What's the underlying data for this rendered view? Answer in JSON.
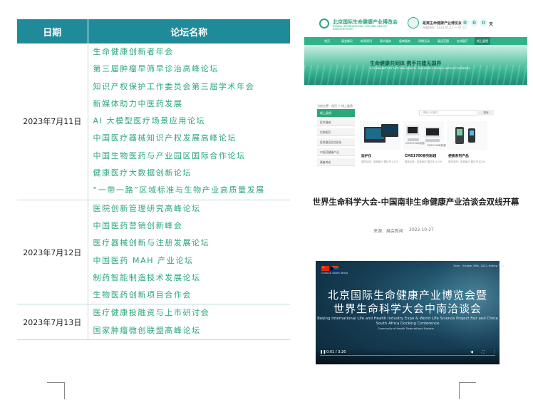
{
  "schedule": {
    "headers": {
      "date": "日期",
      "forum": "论坛名称"
    },
    "rows": [
      {
        "date": "2023年7月11日",
        "forums": [
          "生命健康创新者年会",
          "第三届肿瘤早筛早诊治高峰论坛",
          "知识产权保护工作委员会第三届学术年会",
          "新媒体助力中医药发展",
          "AI 大模型医疗场景应用论坛",
          "中国医疗器械知识产权发展高峰论坛",
          "中国生物医药与产业园区国际合作论坛",
          "健康医疗大数据创新论坛",
          "“一带一路”区域标准与生物产业高质量发展"
        ]
      },
      {
        "date": "2023年7月12日",
        "forums": [
          "医院创新管理研究高峰论坛",
          "中国医药营销创新峰会",
          "医疗器械创新与注册发展论坛",
          "中国医药 MAH 产业论坛",
          "制药智能制造技术发展论坛",
          "生物医药创新项目合作会"
        ]
      },
      {
        "date": "2023年7月13日",
        "forums": [
          "医疗健康投融资与上市研讨会",
          "国家肿瘤微创联盟高峰论坛"
        ]
      }
    ]
  },
  "site": {
    "logo_cn": "北京国际生命健康产业博览会",
    "logo_en": "BEIJING INTERNATIONAL LIFE AND HEALTH INDUSTRY EXPO",
    "countdown_title": "距离生命健康产业博览会还有",
    "countdown_date": "开展时间：2023.07.11 — 07.13",
    "countdown_digits": [
      "0",
      "0",
      "0"
    ],
    "countdown_unit": "天",
    "nav": [
      "首页",
      "展会概况",
      "新闻资讯",
      "观众服务",
      "展商服务",
      "同期活动",
      "展品范围",
      "在线展厅",
      "联系我们",
      "线上展馆"
    ],
    "hero_title": "生命健康共同体   携手共建无国界",
    "hero_sub": "A COMMUNITY OF LIFE AND HEALTH · BUILDING A WORLD WITHOUT BORDERS",
    "breadcrumb": "当前位置：首页 > 线上展馆",
    "sidebar": [
      "线上展馆",
      "医疗器械",
      "生物医药",
      "医院建设及信息化",
      "中医药健康产业",
      "康复养老"
    ],
    "search_placeholder": "请输入关键词",
    "search_button": "搜索",
    "products": [
      {
        "name": "监护仪",
        "desc": "展商名称：某某医疗·展位号 A102"
      },
      {
        "name": "CMS1700系列彩超",
        "desc": "展商名称：某某医疗·展位号 A108"
      },
      {
        "name": "便携系列产品",
        "desc": "展商名称：某某医疗·展位号 B206"
      }
    ],
    "product_labels": [
      "CMS1700A彩超",
      "CMS1700B彩超"
    ]
  },
  "article": {
    "title": "世界生命科学大会-中国南非生命健康产业洽谈会双线开幕",
    "source": "来源：展会新闻",
    "date": "2022-10-27"
  },
  "video": {
    "corner_left": "China & South Africa",
    "corner_right": "Time：October 26th, 2022, Beijing Time",
    "title_line1": "北京国际生命健康产业博览会暨",
    "title_line2": "世界生命科学大会中南洽谈会",
    "subtitle_en": "Beijing International Life and Health Industry Expo & World Life Science Project Fair and China South Africa Docking Conference",
    "slogan_en": "Community of Health Trade without Borders",
    "time": "0:01 / 3:26"
  }
}
